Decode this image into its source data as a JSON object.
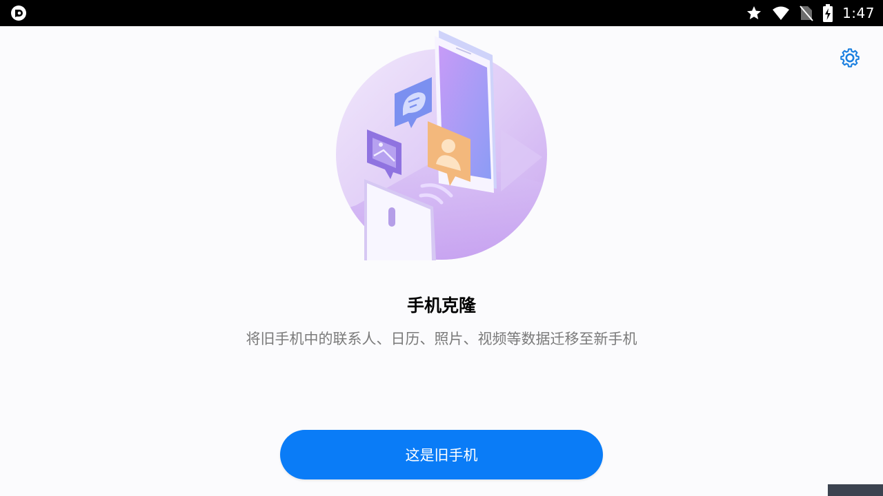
{
  "status_bar": {
    "time": "1:47",
    "icons": [
      "app-notification-icon",
      "star-icon",
      "wifi-icon",
      "no-sim-icon",
      "battery-charging-icon"
    ]
  },
  "settings": {
    "icon": "gear-icon",
    "color": "#1a7fe0"
  },
  "illustration": {
    "icon": "phone-clone-illustration"
  },
  "main": {
    "title": "手机克隆",
    "subtitle": "将旧手机中的联系人、日历、照片、视频等数据迁移至新手机"
  },
  "actions": {
    "old_phone_button": "这是旧手机"
  },
  "colors": {
    "accent": "#0a7cf7",
    "status_bar_bg": "#000000",
    "page_bg": "#fbfbfd"
  }
}
